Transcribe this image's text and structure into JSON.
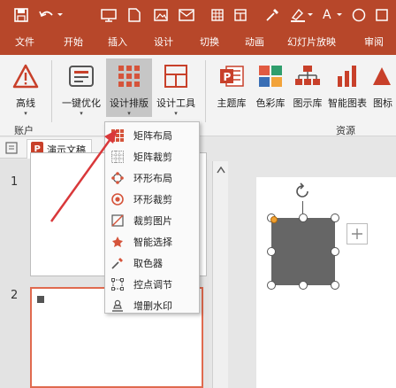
{
  "ribbon_tabs": [
    "文件",
    "开始",
    "插入",
    "设计",
    "切换",
    "动画",
    "幻灯片放映",
    "审阅"
  ],
  "ribbon_buttons": {
    "gaoxian": "高线",
    "optimize": "一键优化",
    "design_layout": "设计排版",
    "design_tools": "设计工具",
    "theme_lib": "主题库",
    "color_lib": "色彩库",
    "diagram_lib": "图示库",
    "smart_chart": "智能图表",
    "more": "图标"
  },
  "groups": {
    "account": "账户",
    "resources": "资源"
  },
  "document_tab": "演示文稿",
  "slides": [
    {
      "number": "1"
    },
    {
      "number": "2"
    }
  ],
  "dropdown_items": [
    {
      "label": "矩阵布局",
      "icon": "matrix-layout-icon"
    },
    {
      "label": "矩阵裁剪",
      "icon": "matrix-crop-icon"
    },
    {
      "label": "环形布局",
      "icon": "ring-layout-icon"
    },
    {
      "label": "环形裁剪",
      "icon": "ring-crop-icon"
    },
    {
      "label": "裁剪图片",
      "icon": "crop-image-icon"
    },
    {
      "label": "智能选择",
      "icon": "smart-select-icon"
    },
    {
      "label": "取色器",
      "icon": "eyedropper-icon"
    },
    {
      "label": "控点调节",
      "icon": "handle-adjust-icon"
    },
    {
      "label": "增删水印",
      "icon": "watermark-icon"
    }
  ],
  "colors": {
    "accent": "#b7472a",
    "ribbon_bg": "#f3f3f3",
    "shape_fill": "#666666",
    "selection": "#e06a4f",
    "annotation_arrow": "#d9383a"
  }
}
